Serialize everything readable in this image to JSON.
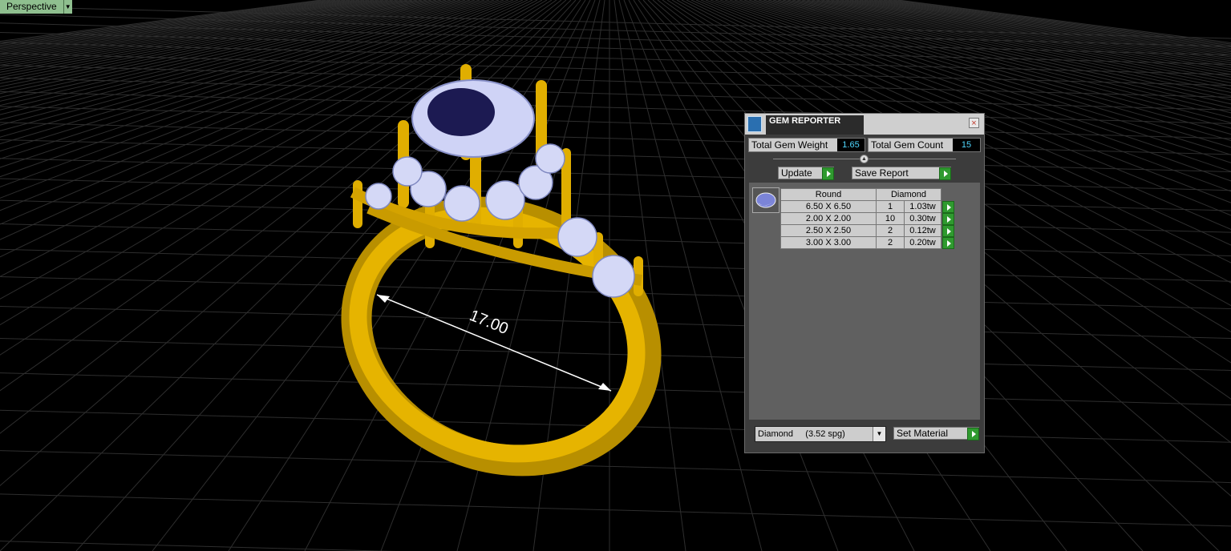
{
  "viewport": {
    "name": "Perspective",
    "dimension_text": "17.00",
    "colors": {
      "background": "#000000",
      "grid": "#2e2e2e",
      "metal": "#d9a800",
      "gem": "#c8cdf5"
    }
  },
  "panel": {
    "title": "GEM REPORTER",
    "close_glyph": "×",
    "total_weight_label": "Total Gem Weight",
    "total_weight_value": "1.65",
    "total_count_label": "Total Gem Count",
    "total_count_value": "15",
    "update_label": "Update",
    "save_report_label": "Save Report",
    "table": {
      "shape_header": "Round",
      "material_header": "Diamond",
      "rows": [
        {
          "size": "6.50 X 6.50",
          "count": "1",
          "weight": "1.03tw"
        },
        {
          "size": "2.00 X 2.00",
          "count": "10",
          "weight": "0.30tw"
        },
        {
          "size": "2.50 X 2.50",
          "count": "2",
          "weight": "0.12tw"
        },
        {
          "size": "3.00 X 3.00",
          "count": "2",
          "weight": "0.20tw"
        }
      ]
    },
    "material_select": "Diamond     (3.52 spg)",
    "set_material_label": "Set Material",
    "accent_green": "#2f9a2f"
  }
}
